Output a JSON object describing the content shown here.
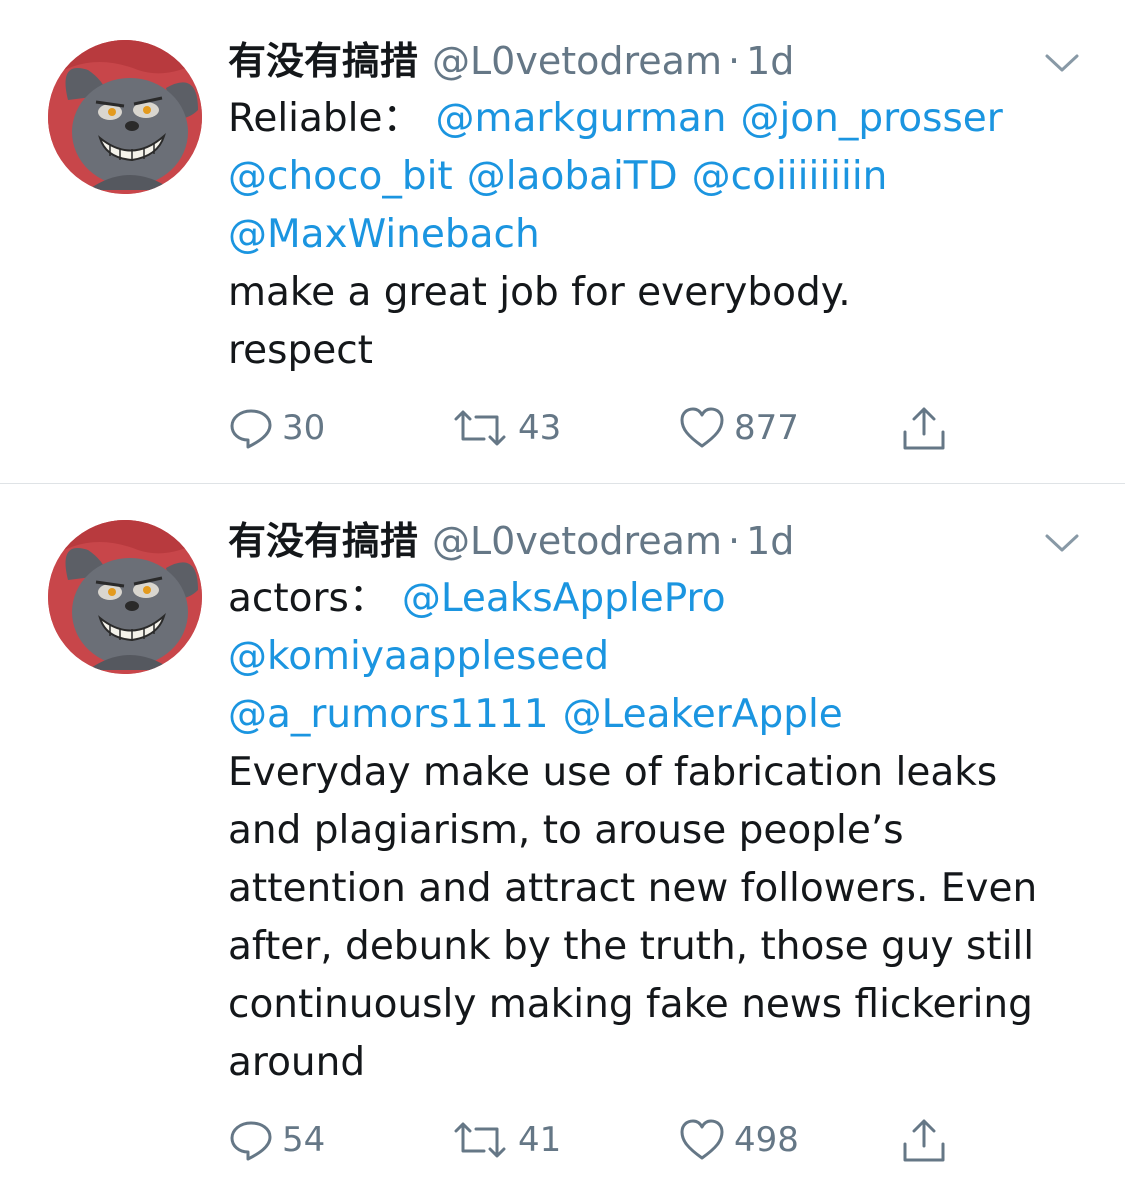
{
  "tweets": [
    {
      "author_name": "有没有搞措",
      "handle": "@L0vetodream",
      "separator": "·",
      "time": "1d",
      "lines": [
        [
          {
            "text": "Reliable：",
            "link": false
          },
          {
            "text": "@markgurman",
            "link": true
          },
          {
            "text": "@jon_prosser",
            "link": true
          }
        ],
        [
          {
            "text": "@choco_bit",
            "link": true
          },
          {
            "text": "@laobaiTD",
            "link": true
          },
          {
            "text": "@coiiiiiiiin",
            "link": true
          }
        ],
        [
          {
            "text": "@MaxWinebach",
            "link": true
          }
        ],
        [
          {
            "text": "make a great job for everybody.",
            "link": false
          }
        ],
        [
          {
            "text": "respect",
            "link": false
          }
        ]
      ],
      "replies": "30",
      "retweets": "43",
      "likes": "877"
    },
    {
      "author_name": "有没有搞措",
      "handle": "@L0vetodream",
      "separator": "·",
      "time": "1d",
      "lines": [
        [
          {
            "text": "actors：",
            "link": false
          },
          {
            "text": "@LeaksApplePro",
            "link": true
          }
        ],
        [
          {
            "text": "@komiyaappleseed",
            "link": true
          }
        ],
        [
          {
            "text": "@a_rumors1111",
            "link": true
          },
          {
            "text": "@LeakerApple",
            "link": true
          }
        ],
        [
          {
            "text": "Everyday make use of fabrication leaks",
            "link": false
          }
        ],
        [
          {
            "text": "and plagiarism, to arouse people’s",
            "link": false
          }
        ],
        [
          {
            "text": "attention and attract new followers. Even",
            "link": false
          }
        ],
        [
          {
            "text": "after, debunk by the truth, those guy still",
            "link": false
          }
        ],
        [
          {
            "text": "continuously making fake news flickering",
            "link": false
          }
        ],
        [
          {
            "text": "around",
            "link": false
          }
        ]
      ],
      "replies": "54",
      "retweets": "41",
      "likes": "498"
    }
  ],
  "icons": {
    "avatar": "cartoon-cat-avatar",
    "menu": "chevron-down-icon",
    "reply": "reply-icon",
    "retweet": "retweet-icon",
    "like": "heart-icon",
    "share": "share-icon"
  },
  "colors": {
    "link": "#1b95e0",
    "secondary_text": "#657786",
    "divider": "#dfe3e6",
    "avatar_background": "#c8464a"
  }
}
